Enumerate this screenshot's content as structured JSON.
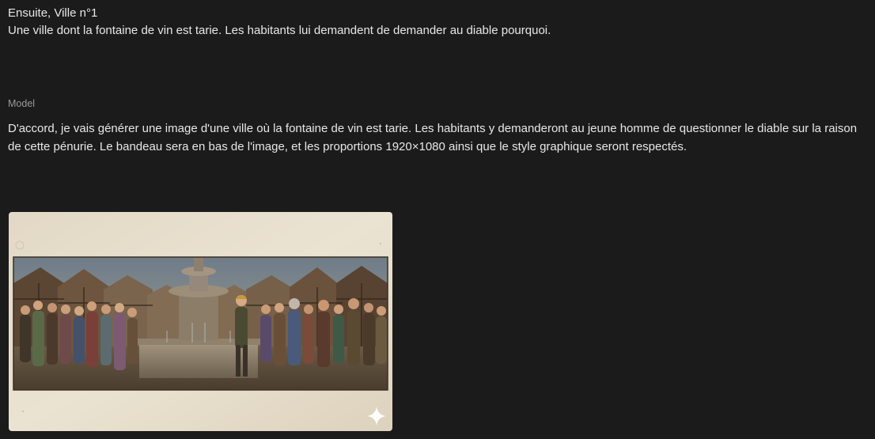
{
  "user_message": {
    "line1": "Ensuite, Ville n°1",
    "line2": "Une ville dont la fontaine de vin est tarie. Les habitants lui demandent de demander au diable pourquoi."
  },
  "model": {
    "label": "Model",
    "response": "D'accord, je vais générer une image d'une ville où la fontaine de vin est tarie. Les habitants y demanderont au jeune homme de questionner le diable sur la raison de cette pénurie. Le bandeau sera en bas de l'image, et les proportions 1920×1080 ainsi que le style graphique seront respectés."
  },
  "image": {
    "subject": "medieval town square with dry wine fountain and crowd of villagers around a young man",
    "icon": "sparkle-icon"
  }
}
